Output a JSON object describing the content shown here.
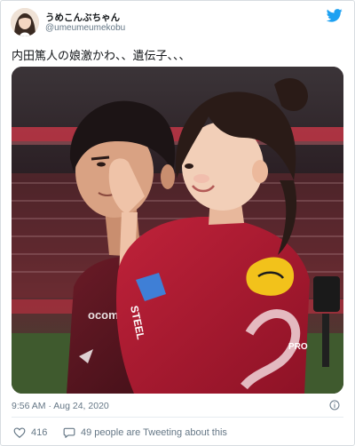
{
  "tweet": {
    "display_name": "うめこんぶちゃん",
    "handle": "@umeumeumekobu",
    "text": "内田篤人の娘激かわ、、遺伝子、、、",
    "timestamp": "9:56 AM · Aug 24, 2020"
  },
  "photo": {
    "jersey_text_left": "STEEL",
    "jersey_text_right": "PRO",
    "jersey_text_man": "ocom"
  },
  "actions": {
    "like_count": "416",
    "discussion_text": "49 people are Tweeting about this"
  },
  "icons": {
    "brand": "twitter-bird-icon",
    "info": "info-icon",
    "like": "heart-icon",
    "discuss": "speech-bubble-icon"
  },
  "colors": {
    "brand_blue": "#1da1f2",
    "secondary_text": "#657786",
    "jersey_red": "#a3182f"
  }
}
